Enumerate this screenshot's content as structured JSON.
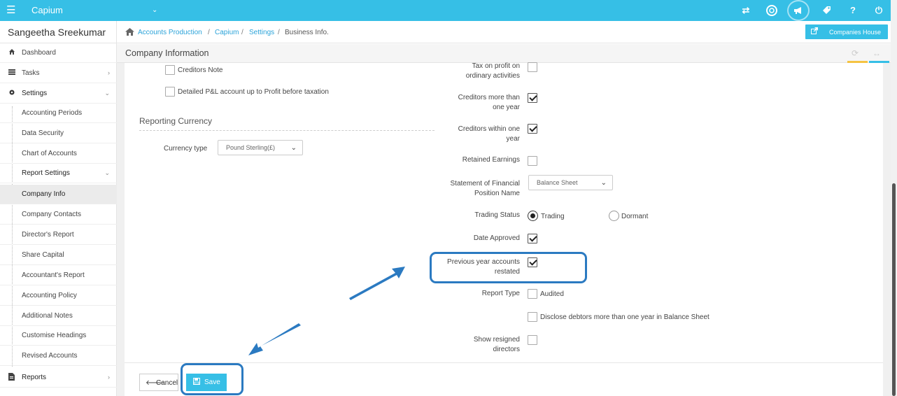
{
  "topbar": {
    "menu_icon": "hamburger-icon",
    "app_name": "Capium",
    "dropdown_glyph": "⌄",
    "icons": [
      "swap-icon",
      "capium-logo-icon",
      "megaphone-icon",
      "tag-icon",
      "help-icon",
      "power-icon"
    ]
  },
  "sidebar": {
    "user_name": "Sangeetha Sreekumar",
    "items": [
      {
        "label": "Dashboard",
        "icon": "dashboard-icon"
      },
      {
        "label": "Tasks",
        "icon": "tasks-icon"
      },
      {
        "label": "Settings",
        "icon": "settings-icon"
      },
      {
        "label": "Accounting Periods"
      },
      {
        "label": "Data Security"
      },
      {
        "label": "Chart of Accounts"
      },
      {
        "label": "Report Settings"
      },
      {
        "label": "Company Info"
      },
      {
        "label": "Company Contacts"
      },
      {
        "label": "Director's Report"
      },
      {
        "label": "Share Capital"
      },
      {
        "label": "Accountant's Report"
      },
      {
        "label": "Accounting Policy"
      },
      {
        "label": "Additional Notes"
      },
      {
        "label": "Customise Headings"
      },
      {
        "label": "Revised Accounts"
      },
      {
        "label": "Reports",
        "icon": "reports-icon"
      }
    ]
  },
  "breadcrumb": {
    "items": [
      "Accounts Production",
      "Capium",
      "Settings",
      "Business Info."
    ],
    "separator": "/"
  },
  "header_button": {
    "label": "Companies House",
    "icon": "external-link-icon"
  },
  "panel": {
    "title": "Company Information"
  },
  "left_column": {
    "creditors_note": {
      "label": "Creditors Note",
      "checked": false
    },
    "detailed_pl": {
      "label": "Detailed P&L account up to Profit before taxation",
      "checked": false
    },
    "reporting_currency_title": "Reporting Currency",
    "currency_type_label": "Currency type",
    "currency_value": "Pound Sterling(£)"
  },
  "right_column": {
    "tax_on_profit": {
      "line1": "Tax on profit on",
      "line2": "ordinary activities",
      "checked": false
    },
    "creditors_more": {
      "line1": "Creditors more than",
      "line2": "one year",
      "checked": true
    },
    "creditors_within": {
      "line1": "Creditors within one",
      "line2": "year",
      "checked": true
    },
    "retained_earnings": {
      "label": "Retained Earnings",
      "checked": false
    },
    "sfp_name": {
      "line1": "Statement of Financial",
      "line2": "Position Name",
      "value": "Balance Sheet"
    },
    "trading_status": {
      "label": "Trading Status",
      "option1": "Trading",
      "option2": "Dormant",
      "selected": "Trading"
    },
    "date_approved": {
      "label": "Date Approved",
      "checked": true
    },
    "prev_year_restated": {
      "line1": "Previous year accounts",
      "line2": "restated",
      "checked": true
    },
    "report_type": {
      "label": "Report Type",
      "option_label": "Audited",
      "checked": false
    },
    "disclose_debtors": {
      "label": "Disclose debtors more than one year in Balance Sheet",
      "checked": false
    },
    "show_resigned": {
      "line1": "Show resigned",
      "line2": "directors",
      "checked": false
    }
  },
  "buttons": {
    "cancel": "Cancel",
    "save": "Save"
  },
  "colors": {
    "accent": "#36bfe6",
    "highlight": "#2b7ac1",
    "link": "#2ba3d9",
    "tab_yellow": "#f5c342"
  }
}
